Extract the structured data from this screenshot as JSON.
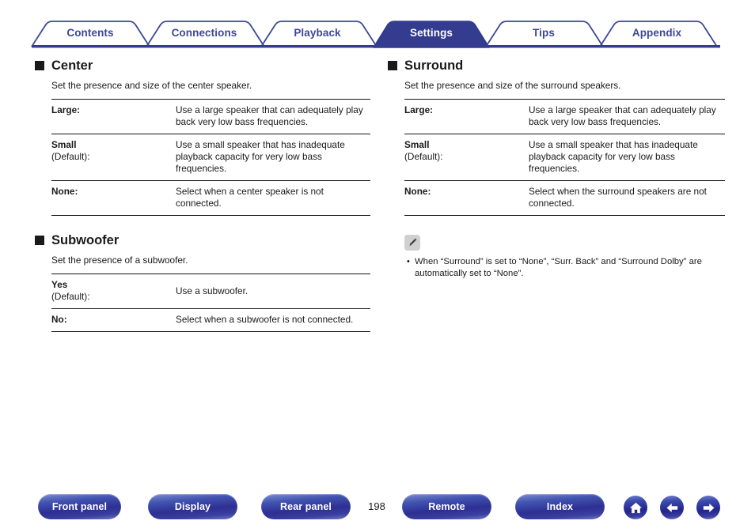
{
  "colors": {
    "tab_blue": "#3d4796",
    "tab_active_fill": "#333c8e",
    "text": "#1a1a1a",
    "rule": "#141414",
    "note_icon_bg": "#d0d0d0",
    "button_blue": "#2d2f93"
  },
  "tabs": [
    {
      "label": "Contents",
      "active": false
    },
    {
      "label": "Connections",
      "active": false
    },
    {
      "label": "Playback",
      "active": false
    },
    {
      "label": "Settings",
      "active": true
    },
    {
      "label": "Tips",
      "active": false
    },
    {
      "label": "Appendix",
      "active": false
    }
  ],
  "left_column": {
    "sections": [
      {
        "title": "Center",
        "description": "Set the presence and size of the center speaker.",
        "rows": [
          {
            "term": "Large:",
            "term_default": "",
            "description": "Use a large speaker that can adequately play back very low bass frequencies.",
            "center": false
          },
          {
            "term": "Small",
            "term_default": "(Default):",
            "description": "Use a small speaker that has inadequate playback capacity for very low bass frequencies.",
            "center": false
          },
          {
            "term": "None:",
            "term_default": "",
            "description": "Select when a center speaker is not connected.",
            "center": false
          }
        ]
      },
      {
        "title": "Subwoofer",
        "description": "Set the presence of a subwoofer.",
        "rows": [
          {
            "term": "Yes",
            "term_default": "(Default):",
            "description": "Use a subwoofer.",
            "center": true
          },
          {
            "term": "No:",
            "term_default": "",
            "description": "Select when a subwoofer is not connected.",
            "center": false
          }
        ]
      }
    ]
  },
  "right_column": {
    "sections": [
      {
        "title": "Surround",
        "description": "Set the presence and size of the surround speakers.",
        "rows": [
          {
            "term": "Large:",
            "term_default": "",
            "description": "Use a large speaker that can adequately play back very low bass frequencies.",
            "center": false
          },
          {
            "term": "Small",
            "term_default": "(Default):",
            "description": "Use a small speaker that has inadequate playback capacity for very low bass frequencies.",
            "center": false
          },
          {
            "term": "None:",
            "term_default": "",
            "description": "Select when the surround speakers are not connected.",
            "center": false
          }
        ]
      }
    ],
    "note": {
      "icon": "pencil-note-icon",
      "items": [
        "When “Surround” is set to “None”, “Surr. Back” and “Surround Dolby” are automatically set to “None”."
      ]
    }
  },
  "bottom_bar": {
    "buttons": [
      {
        "label": "Front panel",
        "name": "front-panel-button"
      },
      {
        "label": "Display",
        "name": "display-button"
      },
      {
        "label": "Rear panel",
        "name": "rear-panel-button"
      },
      {
        "label": "Remote",
        "name": "remote-button"
      },
      {
        "label": "Index",
        "name": "index-button"
      }
    ],
    "page_number": "198",
    "icon_buttons": [
      {
        "icon": "home-icon",
        "name": "home-button"
      },
      {
        "icon": "arrow-left-icon",
        "name": "previous-page-button"
      },
      {
        "icon": "arrow-right-icon",
        "name": "next-page-button"
      }
    ]
  }
}
